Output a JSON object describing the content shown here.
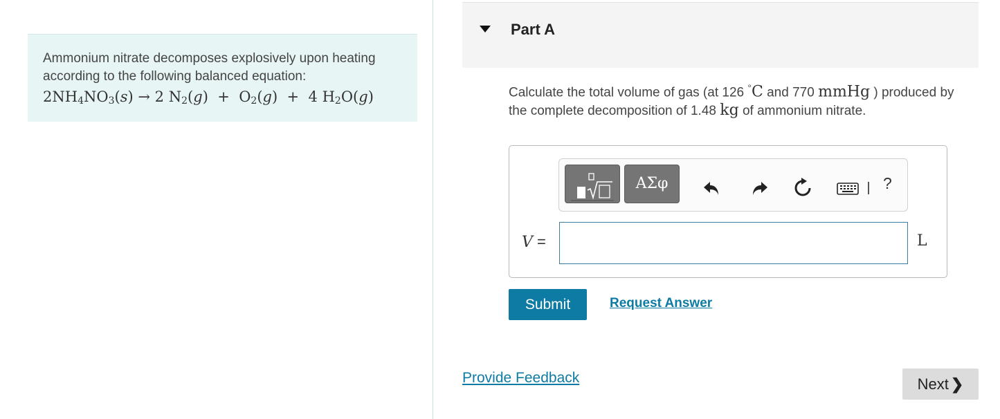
{
  "intro": {
    "text": "Ammonium nitrate decomposes explosively upon heating according to the following balanced equation:",
    "equation": {
      "reactant_coef": "2",
      "reactant": [
        "NH",
        "4",
        "NO",
        "3"
      ],
      "reactant_state": "s",
      "arrow": "→",
      "p1_coef": "2",
      "p1": [
        "N",
        "2"
      ],
      "p1_state": "g",
      "plus": "+",
      "p2": [
        "O",
        "2"
      ],
      "p2_state": "g",
      "p3_coef": "4",
      "p3": [
        "H",
        "2",
        "O"
      ],
      "p3_state": "g"
    }
  },
  "part": {
    "title": "Part A"
  },
  "question": {
    "pre": "Calculate the total volume of gas (at 126 ",
    "degree": "°",
    "temp_unit": "C",
    "mid1": " and 770 ",
    "pressure_unit": "mmHg",
    "mid2": " ) produced by the complete decomposition of 1.48 ",
    "mass_unit": "kg",
    "post": " of ammonium nitrate."
  },
  "toolbar": {
    "greek_label": "ΑΣφ",
    "help_label": "?"
  },
  "answer": {
    "variable": "V",
    "equals": " = ",
    "value": "",
    "unit": "L"
  },
  "actions": {
    "submit_label": "Submit",
    "request_answer_label": "Request Answer",
    "feedback_label": "Provide Feedback",
    "next_label": "Next",
    "next_chevron": "❯"
  },
  "colors": {
    "accent": "#0d7ba3",
    "intro_bg": "#e8f5f5",
    "header_bg": "#f4f4f4",
    "toolbar_btn": "#757575"
  }
}
